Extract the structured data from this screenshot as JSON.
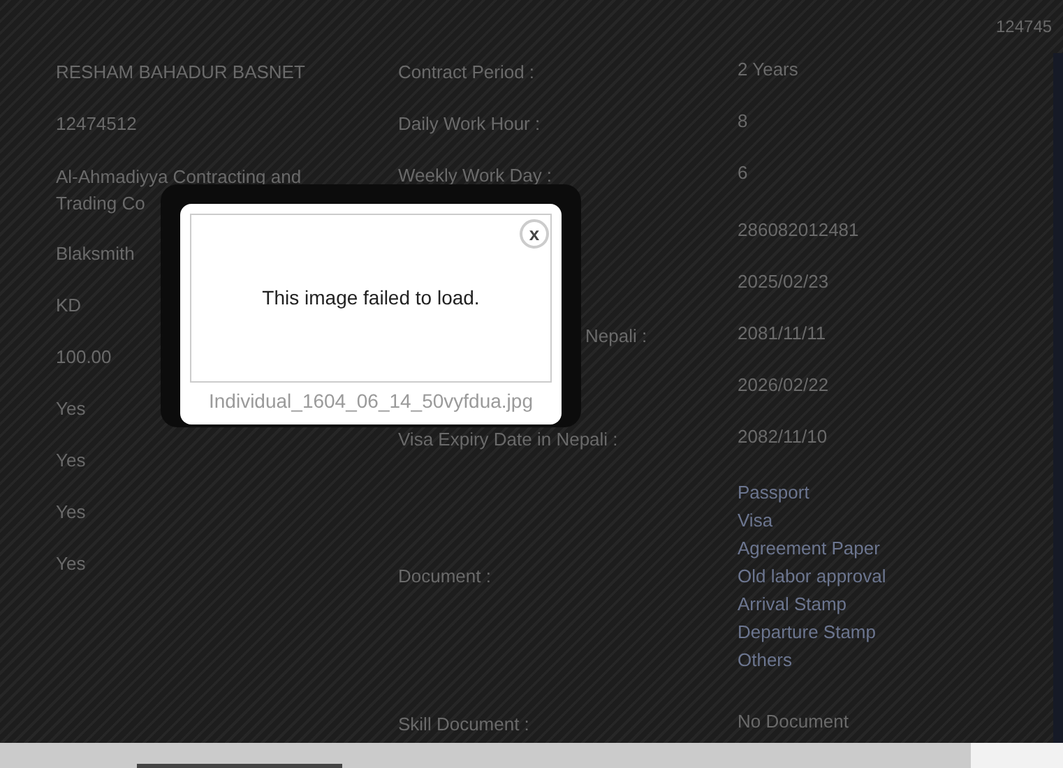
{
  "page": {
    "corner_text": "124745",
    "applicant": [
      "RESHAM BAHADUR BASNET",
      "12474512",
      "Al-Ahmadiyya Contracting and Trading Co",
      "Blaksmith",
      "KD",
      "100.00",
      "Yes",
      "Yes",
      "Yes",
      "Yes"
    ],
    "details": [
      {
        "kind": "text",
        "label": "Contract Period :",
        "value": "2 Years"
      },
      {
        "kind": "text",
        "label": "Daily Work Hour :",
        "value": "8"
      },
      {
        "kind": "text",
        "label": "Weekly Work Day :",
        "value": "6"
      },
      {
        "kind": "text",
        "value": "286082012481"
      },
      {
        "kind": "text",
        "value": "2025/02/23"
      },
      {
        "kind": "text",
        "label": "Nepali :",
        "value": "2081/11/11"
      },
      {
        "kind": "text",
        "value": "2026/02/22"
      },
      {
        "kind": "text",
        "label": "Visa Expiry Date in Nepali :",
        "value": "2082/11/10"
      },
      {
        "kind": "documents",
        "label": "Document :",
        "documents": [
          "Passport",
          "Visa",
          "Agreement Paper",
          "Old labor approval",
          "Arrival Stamp",
          "Departure Stamp",
          "Others"
        ]
      },
      {
        "kind": "text",
        "label": "Skill Document :",
        "value": "No Document"
      }
    ]
  },
  "lightbox": {
    "message": "This image failed to load.",
    "caption": "Individual_1604_06_14_50vyfdua.jpg",
    "close": "x"
  }
}
